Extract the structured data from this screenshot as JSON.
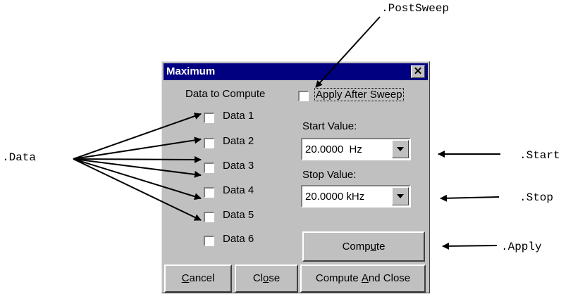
{
  "annotations": {
    "post_sweep": ".PostSweep",
    "data": ".Data",
    "start": ".Start",
    "stop": ".Stop",
    "apply": ".Apply"
  },
  "dialog": {
    "title": "Maximum",
    "close_glyph": "✕",
    "data_to_compute_label": "Data to Compute",
    "apply_after_sweep": {
      "label": "Apply After Sweep",
      "checked": false
    },
    "data_items": [
      {
        "label": "Data 1",
        "checked": false
      },
      {
        "label": "Data 2",
        "checked": false
      },
      {
        "label": "Data 3",
        "checked": false
      },
      {
        "label": "Data 4",
        "checked": false
      },
      {
        "label": "Data 5",
        "checked": false
      },
      {
        "label": "Data 6",
        "checked": false
      }
    ],
    "start_value": {
      "label": "Start Value:",
      "value": "20.0000  Hz"
    },
    "stop_value": {
      "label": "Stop Value:",
      "value": "20.0000 kHz"
    },
    "buttons": {
      "compute": {
        "pre": "Comp",
        "mnemonic": "u",
        "post": "te"
      },
      "cancel": {
        "pre": "",
        "mnemonic": "C",
        "post": "ancel"
      },
      "close": {
        "pre": "Cl",
        "mnemonic": "o",
        "post": "se"
      },
      "compute_and_close": {
        "pre": "Compute ",
        "mnemonic": "A",
        "post": "nd Close"
      }
    }
  },
  "colors": {
    "dialog_face": "#c0c0c0",
    "title_bar": "#000080",
    "title_text": "#ffffff"
  }
}
